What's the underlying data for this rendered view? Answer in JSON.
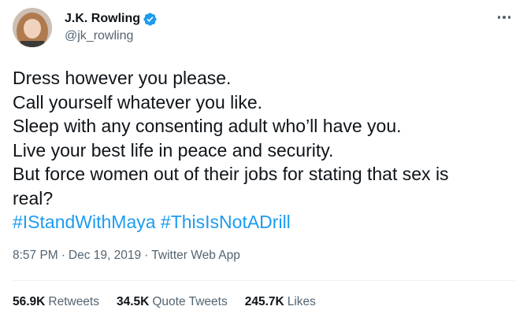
{
  "author": {
    "display_name": "J.K. Rowling",
    "handle": "@jk_rowling",
    "verified": true
  },
  "icons": {
    "avatar": "profile-photo",
    "verified": "verified-badge-icon",
    "more": "more-options-icon"
  },
  "colors": {
    "link": "#1d9bf0",
    "text": "#0f1419",
    "secondary": "#536471",
    "divider": "#eff3f4"
  },
  "tweet": {
    "lines": [
      "Dress however you please.",
      "Call yourself whatever you like.",
      "Sleep with any consenting adult who’ll have you.",
      "Live your best life in peace and security.",
      "But force women out of their jobs for stating that sex is",
      "real?"
    ],
    "hashtags": [
      "#IStandWithMaya",
      "#ThisIsNotADrill"
    ]
  },
  "meta": {
    "time": "8:57 PM",
    "separator": "·",
    "date": "Dec 19, 2019",
    "source": "Twitter Web App"
  },
  "stats": [
    {
      "value": "56.9K",
      "label": "Retweets"
    },
    {
      "value": "34.5K",
      "label": "Quote Tweets"
    },
    {
      "value": "245.7K",
      "label": "Likes"
    }
  ]
}
